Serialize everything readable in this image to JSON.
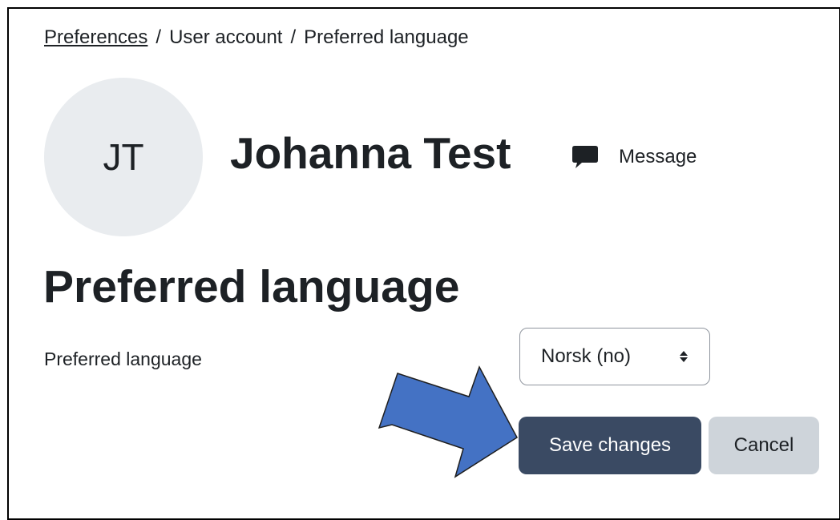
{
  "breadcrumb": {
    "items": [
      "Preferences",
      "User account",
      "Preferred language"
    ],
    "separator": "/"
  },
  "profile": {
    "initials": "JT",
    "name": "Johanna Test",
    "message_label": "Message",
    "message_icon": "speech-bubble-icon"
  },
  "page": {
    "heading": "Preferred language"
  },
  "form": {
    "language_label": "Preferred language",
    "language_selected": "Norsk (no)",
    "save_label": "Save changes",
    "cancel_label": "Cancel"
  },
  "annotation": {
    "arrow_color": "#4472c4",
    "arrow_outline": "#1f1f1f"
  },
  "colors": {
    "primary_button": "#3a4a63",
    "secondary_button": "#ced4da",
    "avatar_bg": "#e9ecef"
  }
}
